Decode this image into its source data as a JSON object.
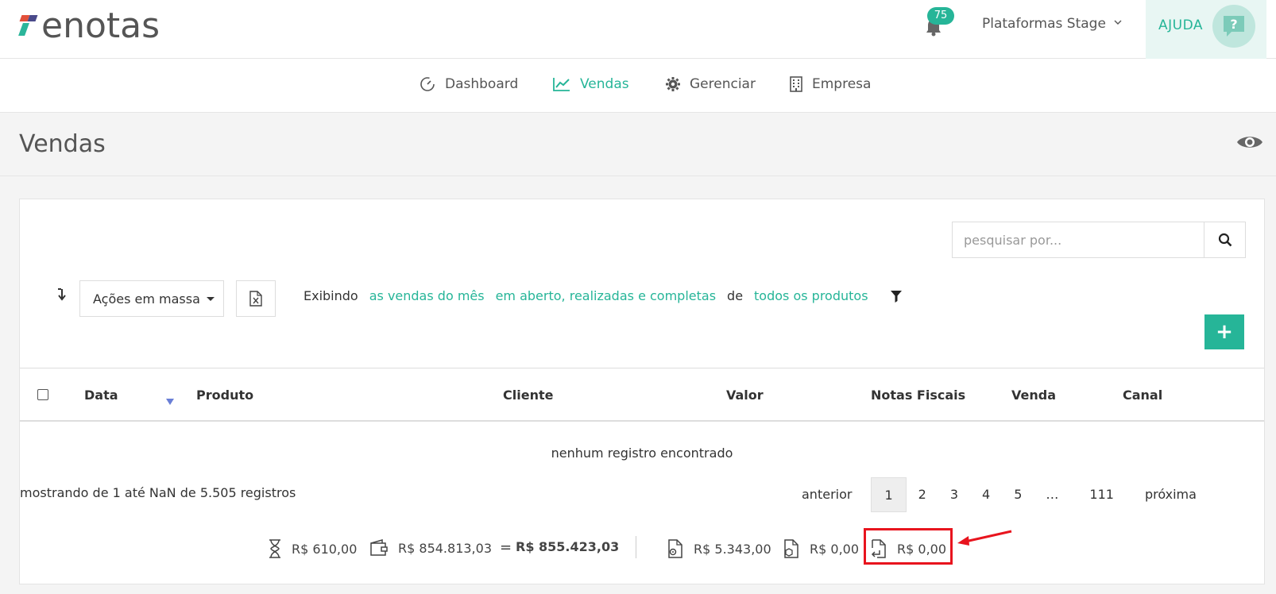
{
  "header": {
    "logo_text": "enotas",
    "notifications_count": "75",
    "platform_label": "Plataformas Stage",
    "help_label": "AJUDA"
  },
  "nav": {
    "items": [
      {
        "label": "Dashboard",
        "icon": "dashboard-gauge-icon",
        "active": false
      },
      {
        "label": "Vendas",
        "icon": "line-chart-icon",
        "active": true
      },
      {
        "label": "Gerenciar",
        "icon": "gear-icon",
        "active": false
      },
      {
        "label": "Empresa",
        "icon": "building-icon",
        "active": false
      }
    ]
  },
  "page": {
    "title": "Vendas"
  },
  "toolbar": {
    "search_placeholder": "pesquisar por...",
    "mass_actions_label": "Ações em massa",
    "filter_prefix": "Exibindo",
    "filter_period": "as vendas do mês",
    "filter_status": "em aberto, realizadas e completas",
    "filter_of": "de",
    "filter_products": "todos os produtos",
    "add_label": "+"
  },
  "table": {
    "columns": [
      "Data",
      "Produto",
      "Cliente",
      "Valor",
      "Notas Fiscais",
      "Venda",
      "Canal"
    ],
    "empty_message": "nenhum registro encontrado"
  },
  "pagination": {
    "summary": "mostrando de 1 até NaN de 5.505 registros",
    "prev_label": "anterior",
    "pages": [
      "1",
      "2",
      "3",
      "4",
      "5",
      "…",
      "111"
    ],
    "current_page": "1",
    "next_label": "próxima"
  },
  "totals": {
    "pending": "R$ 610,00",
    "received": "R$ 854.813,03",
    "equals": "=",
    "sum": "R$ 855.423,03",
    "invoices_issued": "R$ 5.343,00",
    "invoices_product": "R$ 0,00",
    "refunds": "R$ 0,00"
  },
  "colors": {
    "accent": "#26b598",
    "highlight": "#e8141e",
    "sort_indicator": "#6a7fd6"
  }
}
